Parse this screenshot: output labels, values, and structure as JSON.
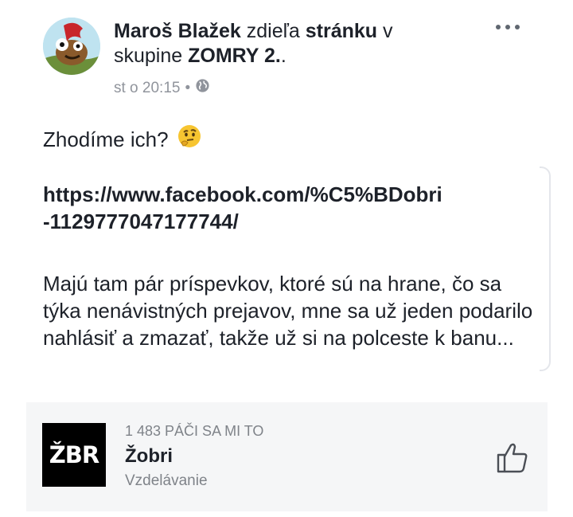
{
  "post": {
    "author": "Maroš Blažek",
    "action": "zdieľa",
    "object": "stránku",
    "preposition": "v",
    "group_label": "skupine",
    "group_name": "ZOMRY 2.",
    "period": ".",
    "timestamp": "st o 20:15",
    "separator": "•",
    "privacy_icon": "globe-icon",
    "more_icon": "more-options-icon",
    "text_line1": "Zhodíme ich?",
    "emoji": "thinking-face-emoji",
    "link": "https://www.facebook.com/%C5%BDobri-1129777047177744/",
    "paragraph": "Majú tam pár príspevkov, ktoré sú na hrane, čo sa týka nenávistných prejavov, mne sa už jeden podarilo nahlásiť a zmazať, takže už si na polceste k banu..."
  },
  "shared_page": {
    "logo_text": "ŽBR",
    "likes": "1 483 PÁČI SA MI TO",
    "name": "Žobri",
    "category": "Vzdelávanie",
    "like_icon": "thumbs-up-icon"
  },
  "colors": {
    "text": "#1d2129",
    "muted": "#90949c",
    "card_bg": "#f5f6f7",
    "logo_bg": "#000000"
  }
}
